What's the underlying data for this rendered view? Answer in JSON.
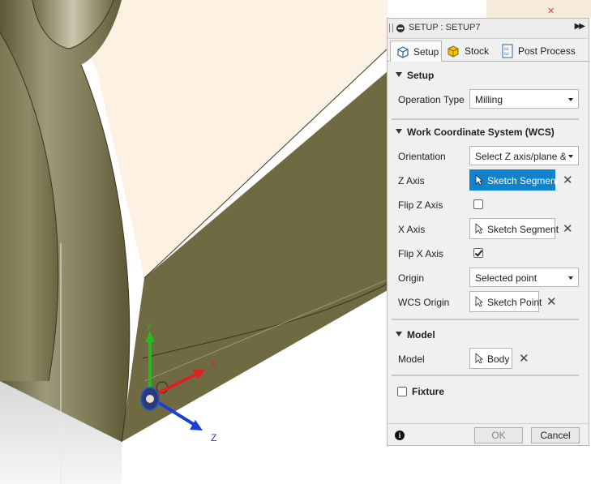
{
  "viewport": {
    "triad": {
      "y_label": "Y",
      "x_label": "X",
      "z_label": "Z"
    },
    "colors": {
      "body_face": "#6f6a42",
      "top_face": "#fdf1e3",
      "y_axis": "#22bb22",
      "x_axis": "#dd2222",
      "z_axis": "#1a3fd6"
    }
  },
  "panel": {
    "title": "SETUP : SETUP7",
    "tabs": [
      {
        "label": "Setup",
        "icon": "setup-cube-icon",
        "active": true
      },
      {
        "label": "Stock",
        "icon": "stock-cube-icon",
        "active": false
      },
      {
        "label": "Post Process",
        "icon": "post-process-icon",
        "active": false
      }
    ],
    "setup_section": {
      "title": "Setup",
      "operation_type_label": "Operation Type",
      "operation_type_value": "Milling"
    },
    "wcs_section": {
      "title": "Work Coordinate System (WCS)",
      "orientation_label": "Orientation",
      "orientation_value": "Select Z axis/plane & X axis",
      "z_axis_label": "Z Axis",
      "z_axis_value": "Sketch Segment",
      "flip_z_label": "Flip Z Axis",
      "flip_z_checked": false,
      "x_axis_label": "X Axis",
      "x_axis_value": "Sketch Segment",
      "flip_x_label": "Flip X Axis",
      "flip_x_checked": true,
      "origin_label": "Origin",
      "origin_value": "Selected point",
      "wcs_origin_label": "WCS Origin",
      "wcs_origin_value": "Sketch Point"
    },
    "model_section": {
      "title": "Model",
      "model_label": "Model",
      "model_value": "Body"
    },
    "fixture_section": {
      "title": "Fixture",
      "checked": false
    },
    "footer": {
      "ok_label": "OK",
      "cancel_label": "Cancel"
    },
    "accent_color": "#0f83d0"
  }
}
